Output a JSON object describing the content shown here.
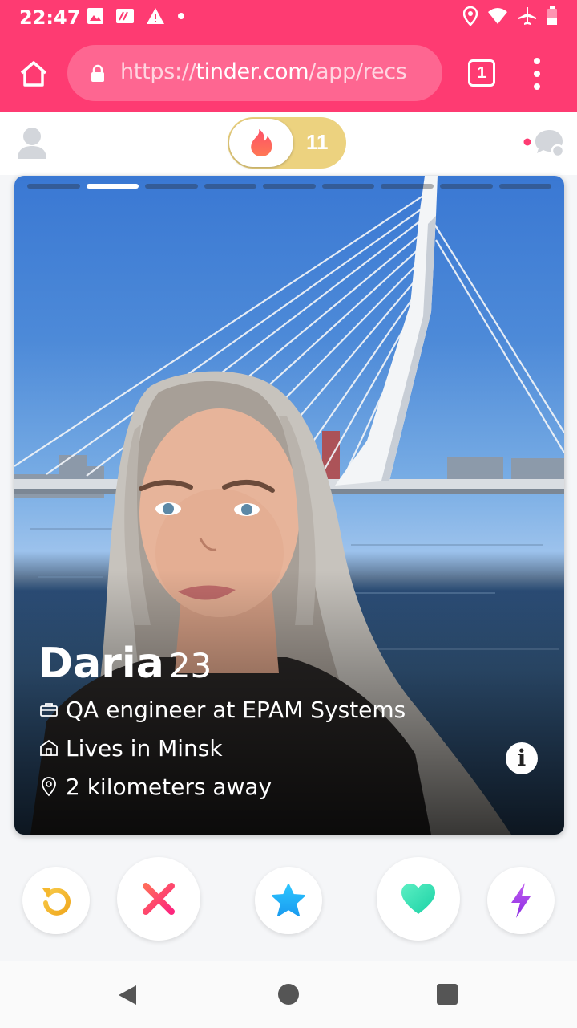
{
  "status_bar": {
    "time": "22:47",
    "icons_left": [
      "image-icon",
      "sim-card-icon",
      "warning-icon",
      "dot-icon"
    ],
    "icons_right": [
      "location-icon",
      "wifi-icon",
      "airplane-icon",
      "battery-low-icon"
    ]
  },
  "browser": {
    "url_scheme": "https://",
    "url_host": "tinder.com",
    "url_path": "/app/recs",
    "tab_count": "1"
  },
  "app": {
    "boost_count": "11",
    "messages_has_notification": true,
    "accent_color": "#fe3b72"
  },
  "profile": {
    "name": "Daria",
    "age": "23",
    "job": "QA engineer at EPAM Systems",
    "city": "Lives in Minsk",
    "distance": "2 kilometers away",
    "photo_count": 9,
    "active_photo": 2
  },
  "actions": [
    {
      "name": "rewind-button",
      "icon": "undo-icon",
      "color": "#f5b82e"
    },
    {
      "name": "nope-button",
      "icon": "close-icon",
      "color": "#fe4e64"
    },
    {
      "name": "super-like-button",
      "icon": "star-icon",
      "color": "#1fb5f6"
    },
    {
      "name": "like-button",
      "icon": "heart-icon",
      "color": "#34e0a6"
    },
    {
      "name": "boost-button",
      "icon": "lightning-icon",
      "color": "#a543e6"
    }
  ]
}
